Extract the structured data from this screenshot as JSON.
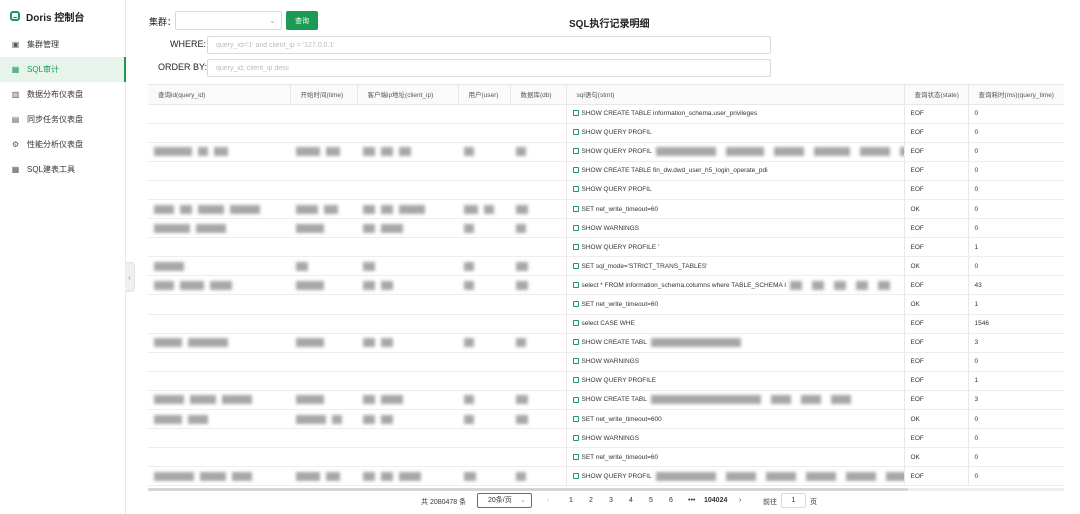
{
  "brand": {
    "title": "Doris 控制台"
  },
  "sidebar": {
    "items": [
      {
        "label": "集群管理",
        "icon": "cluster-icon"
      },
      {
        "label": "SQL审计",
        "icon": "grid-icon",
        "active": true
      },
      {
        "label": "数据分布仪表盘",
        "icon": "bar-chart-icon"
      },
      {
        "label": "同步任务仪表盘",
        "icon": "document-icon"
      },
      {
        "label": "性能分析仪表盘",
        "icon": "gear-icon"
      },
      {
        "label": "SQL建表工具",
        "icon": "grid-icon"
      }
    ]
  },
  "filters": {
    "cluster_label": "集群：",
    "query_button": "查询",
    "where_label": "WHERE:",
    "where_placeholder": "query_id='1' and client_ip = '127.0.0.1'",
    "orderby_label": "ORDER BY:",
    "orderby_placeholder": "query_id, client_ip desc"
  },
  "page_title": "SQL执行记录明细",
  "table": {
    "columns": [
      "查询id(query_id)",
      "开始时间(time)",
      "客户端ip地址(client_ip)",
      "用户(user)",
      "数据库(db)",
      "sql语句(stmt)",
      "查询状态(state)",
      "查询耗时(ms)(query_time)"
    ],
    "rows": [
      {
        "stmt": "SHOW CREATE TABLE information_schema.user_privileges",
        "state": "EOF",
        "time": "0"
      },
      {
        "stmt": "SHOW QUERY PROFIL",
        "state": "EOF",
        "time": "0"
      },
      {
        "stmt": "SHOW QUERY PROFIL",
        "state": "EOF",
        "time": "0"
      },
      {
        "stmt": "SHOW CREATE TABLE fin_dw.dwd_user_h5_login_operate_pdi",
        "state": "EOF",
        "time": "0"
      },
      {
        "stmt": "SHOW QUERY PROFIL",
        "state": "EOF",
        "time": "0"
      },
      {
        "stmt": "SET net_write_timeout=60",
        "state": "OK",
        "time": "0"
      },
      {
        "stmt": "SHOW WARNINGS",
        "state": "EOF",
        "time": "0"
      },
      {
        "stmt": "SHOW QUERY PROFILE '",
        "state": "EOF",
        "time": "1"
      },
      {
        "stmt": "SET sql_mode='STRICT_TRANS_TABLES'",
        "state": "OK",
        "time": "0"
      },
      {
        "stmt": "select * FROM information_schema.columns where TABLE_SCHEMA I",
        "state": "EOF",
        "time": "43"
      },
      {
        "stmt": "SET net_write_timeout=60",
        "state": "OK",
        "time": "1"
      },
      {
        "stmt": "select CASE WHE",
        "state": "EOF",
        "time": "1546"
      },
      {
        "stmt": "SHOW CREATE TABL",
        "state": "EOF",
        "time": "3"
      },
      {
        "stmt": "SHOW WARNINGS",
        "state": "EOF",
        "time": "0"
      },
      {
        "stmt": "SHOW QUERY PROFILE",
        "state": "EOF",
        "time": "1"
      },
      {
        "stmt": "SHOW CREATE TABL",
        "state": "EOF",
        "time": "3"
      },
      {
        "stmt": "SET net_write_timeout=600",
        "state": "OK",
        "time": "0"
      },
      {
        "stmt": "SHOW WARNINGS",
        "state": "EOF",
        "time": "0"
      },
      {
        "stmt": "SET net_write_timeout=60",
        "state": "OK",
        "time": "0"
      },
      {
        "stmt": "SHOW QUERY PROFIL",
        "state": "EOF",
        "time": "0"
      }
    ]
  },
  "pagination": {
    "total": "共 2080478 条",
    "page_size": "20条/页",
    "prev": "‹",
    "pages": [
      "1",
      "2",
      "3",
      "4",
      "5",
      "6"
    ],
    "ellipsis": "•••",
    "last_page": "104024",
    "next": "›",
    "goto_label": "前往",
    "goto_value": "1",
    "goto_suffix": "页"
  }
}
